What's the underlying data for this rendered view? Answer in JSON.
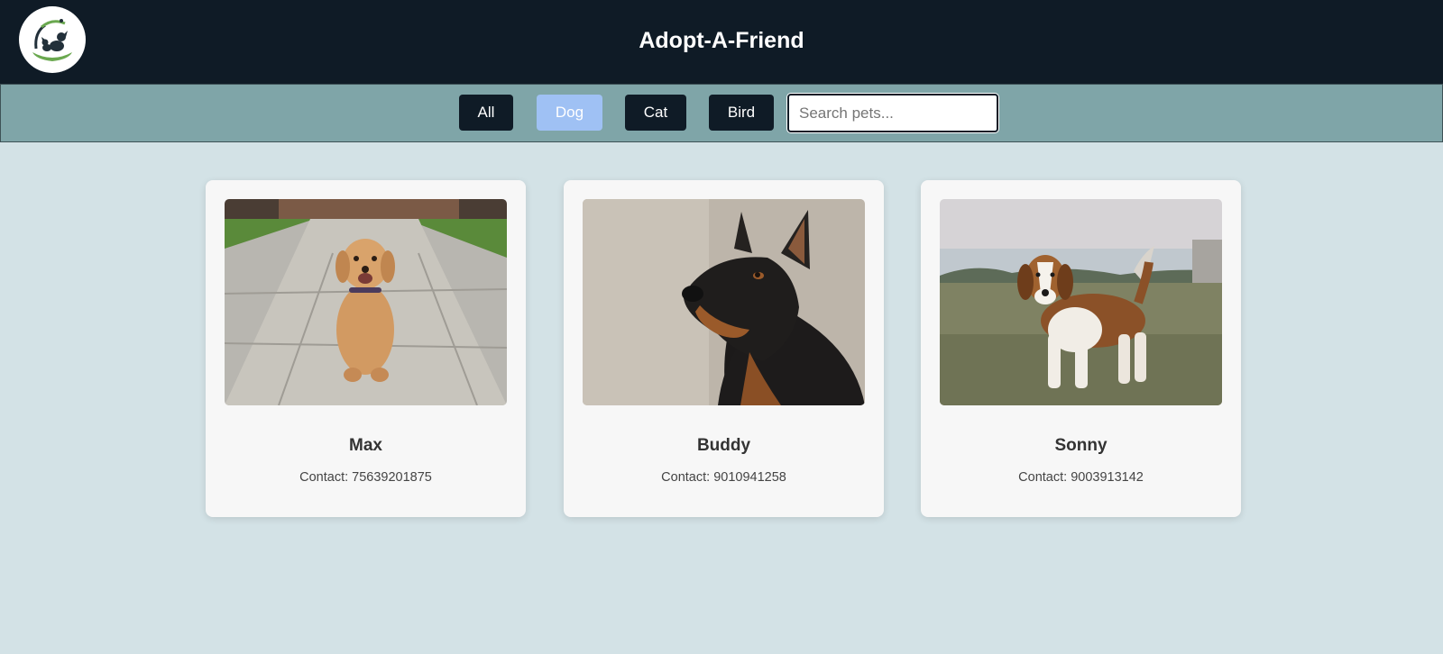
{
  "header": {
    "title": "Adopt-A-Friend",
    "logo_icon": "pet-logo-icon"
  },
  "filters": {
    "buttons": [
      {
        "label": "All",
        "active": false
      },
      {
        "label": "Dog",
        "active": true
      },
      {
        "label": "Cat",
        "active": false
      },
      {
        "label": "Bird",
        "active": false
      }
    ],
    "search": {
      "placeholder": "Search pets...",
      "value": ""
    }
  },
  "pets": [
    {
      "name": "Max",
      "contact_label": "Contact:",
      "contact": "75639201875",
      "image_icon": "golden-retriever-puppy-photo"
    },
    {
      "name": "Buddy",
      "contact_label": "Contact:",
      "contact": "9010941258",
      "image_icon": "doberman-photo"
    },
    {
      "name": "Sonny",
      "contact_label": "Contact:",
      "contact": "9003913142",
      "image_icon": "beagle-photo"
    }
  ],
  "colors": {
    "header_bg": "#0f1b26",
    "filterbar_bg": "#7fa5a8",
    "page_bg": "#d3e2e6",
    "button_bg": "#0f1b26",
    "active_button_bg": "#9fc1f4",
    "card_bg": "#f7f7f7"
  }
}
